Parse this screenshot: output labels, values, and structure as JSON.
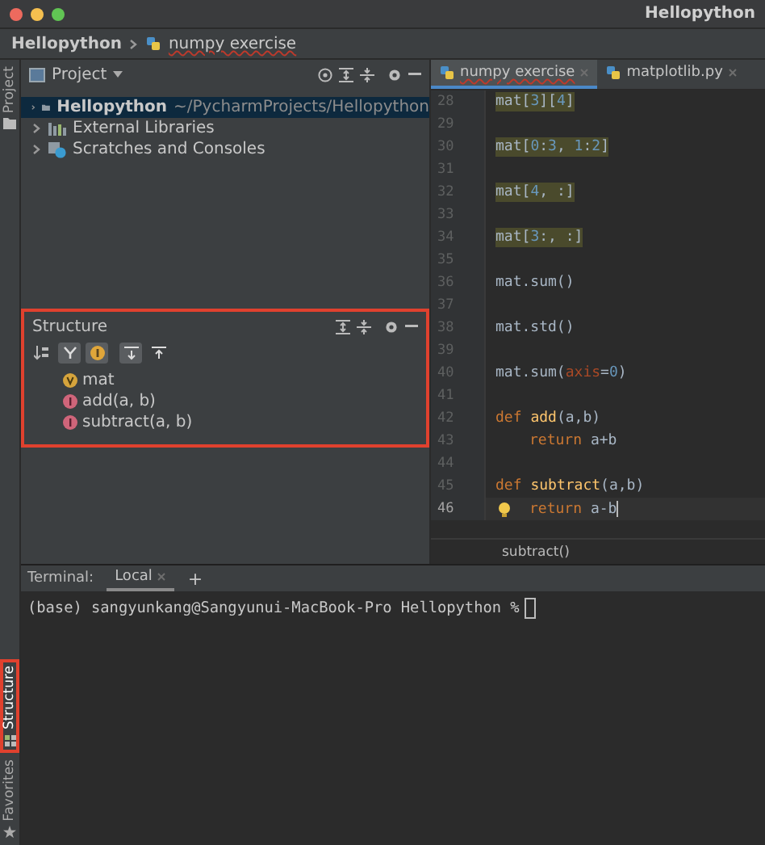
{
  "window": {
    "title": "Hellopython"
  },
  "breadcrumb": [
    {
      "label": "Hellopython",
      "kind": "project"
    },
    {
      "label": "numpy exercise",
      "kind": "file"
    }
  ],
  "tool_stripe": {
    "top": [
      {
        "label": "Project",
        "kind": "folder",
        "highlighted": false
      }
    ],
    "bottom": [
      {
        "label": "Structure",
        "kind": "structure",
        "highlighted": true
      },
      {
        "label": "Favorites",
        "kind": "star",
        "highlighted": false
      }
    ]
  },
  "project_panel": {
    "title": "Project",
    "tree": [
      {
        "name": "Hellopython",
        "path": "~/PycharmProjects/Hellopython",
        "kind": "folder",
        "selected": true,
        "expanded": false
      },
      {
        "name": "External Libraries",
        "kind": "library",
        "selected": false,
        "expanded": false
      },
      {
        "name": "Scratches and Consoles",
        "kind": "scratches",
        "selected": false,
        "expanded": false
      }
    ]
  },
  "structure_panel": {
    "title": "Structure",
    "highlighted": true,
    "toolbar": [
      {
        "kind": "sort",
        "on": false
      },
      {
        "kind": "inherited",
        "on": true
      },
      {
        "kind": "fields",
        "on": true
      },
      {
        "kind": "expand",
        "on": true
      },
      {
        "kind": "collapse",
        "on": false
      }
    ],
    "items": [
      {
        "name": "mat",
        "kind": "variable"
      },
      {
        "name": "add(a, b)",
        "kind": "function"
      },
      {
        "name": "subtract(a, b)",
        "kind": "function"
      }
    ]
  },
  "editor": {
    "tabs": [
      {
        "label": "numpy exercise",
        "selected": true
      },
      {
        "label": "matplotlib.py",
        "selected": false
      }
    ],
    "lines": [
      {
        "number": "28",
        "current": false,
        "highlighted": true,
        "indented": false,
        "tokens": [
          {
            "text": "mat[",
            "kind": "plain"
          },
          {
            "text": "3",
            "kind": "number"
          },
          {
            "text": "][",
            "kind": "plain"
          },
          {
            "text": "4",
            "kind": "number"
          },
          {
            "text": "]",
            "kind": "plain"
          }
        ]
      },
      {
        "number": "29",
        "current": false
      },
      {
        "number": "30",
        "current": false,
        "highlighted": true,
        "indented": false,
        "tokens": [
          {
            "text": "mat[",
            "kind": "plain"
          },
          {
            "text": "0",
            "kind": "number"
          },
          {
            "text": ":",
            "kind": "plain"
          },
          {
            "text": "3",
            "kind": "number"
          },
          {
            "text": ", ",
            "kind": "plain"
          },
          {
            "text": "1",
            "kind": "number"
          },
          {
            "text": ":",
            "kind": "plain"
          },
          {
            "text": "2",
            "kind": "number"
          },
          {
            "text": "]",
            "kind": "plain"
          }
        ]
      },
      {
        "number": "31",
        "current": false
      },
      {
        "number": "32",
        "current": false,
        "highlighted": true,
        "indented": false,
        "tokens": [
          {
            "text": "mat[",
            "kind": "plain"
          },
          {
            "text": "4",
            "kind": "number"
          },
          {
            "text": ", :]",
            "kind": "plain"
          }
        ]
      },
      {
        "number": "33",
        "current": false
      },
      {
        "number": "34",
        "current": false,
        "highlighted": true,
        "indented": false,
        "tokens": [
          {
            "text": "mat[",
            "kind": "plain"
          },
          {
            "text": "3",
            "kind": "number"
          },
          {
            "text": ":, :]",
            "kind": "plain"
          }
        ]
      },
      {
        "number": "35",
        "current": false
      },
      {
        "number": "36",
        "current": false,
        "highlighted": false,
        "indented": false,
        "tokens": [
          {
            "text": "mat.sum()",
            "kind": "plain"
          }
        ]
      },
      {
        "number": "37",
        "current": false
      },
      {
        "number": "38",
        "current": false,
        "highlighted": false,
        "indented": false,
        "tokens": [
          {
            "text": "mat.std()",
            "kind": "plain"
          }
        ]
      },
      {
        "number": "39",
        "current": false
      },
      {
        "number": "40",
        "current": false,
        "highlighted": false,
        "indented": false,
        "tokens": [
          {
            "text": "mat.sum(",
            "kind": "plain"
          },
          {
            "text": "axis",
            "kind": "param"
          },
          {
            "text": "=",
            "kind": "plain"
          },
          {
            "text": "0",
            "kind": "number"
          },
          {
            "text": ")",
            "kind": "plain"
          }
        ]
      },
      {
        "number": "41",
        "current": false
      },
      {
        "number": "42",
        "current": false,
        "highlighted": false,
        "indented": false,
        "tokens": [
          {
            "text": "def ",
            "kind": "keyword"
          },
          {
            "text": "add",
            "kind": "function"
          },
          {
            "text": "(a,b)",
            "kind": "plain"
          }
        ]
      },
      {
        "number": "43",
        "current": false,
        "highlighted": false,
        "indented": true,
        "tokens": [
          {
            "text": "return ",
            "kind": "keyword"
          },
          {
            "text": "a+b",
            "kind": "plain"
          }
        ]
      },
      {
        "number": "44",
        "current": false
      },
      {
        "number": "45",
        "current": false,
        "highlighted": false,
        "indented": false,
        "tokens": [
          {
            "text": "def ",
            "kind": "keyword"
          },
          {
            "text": "subtract",
            "kind": "function"
          },
          {
            "text": "(a,b)",
            "kind": "plain"
          }
        ]
      },
      {
        "number": "46",
        "current": true,
        "highlighted": false,
        "indented": true,
        "tokens": [
          {
            "text": "return ",
            "kind": "keyword"
          },
          {
            "text": "a-b",
            "kind": "plain"
          }
        ]
      }
    ],
    "breadcrumb": "subtract()"
  },
  "terminal": {
    "title": "Terminal:",
    "tabs": [
      {
        "label": "Local",
        "selected": true
      }
    ],
    "add_label": "+",
    "prompt": "(base) sangyunkang@Sangyunui-MacBook-Pro Hellopython %"
  }
}
